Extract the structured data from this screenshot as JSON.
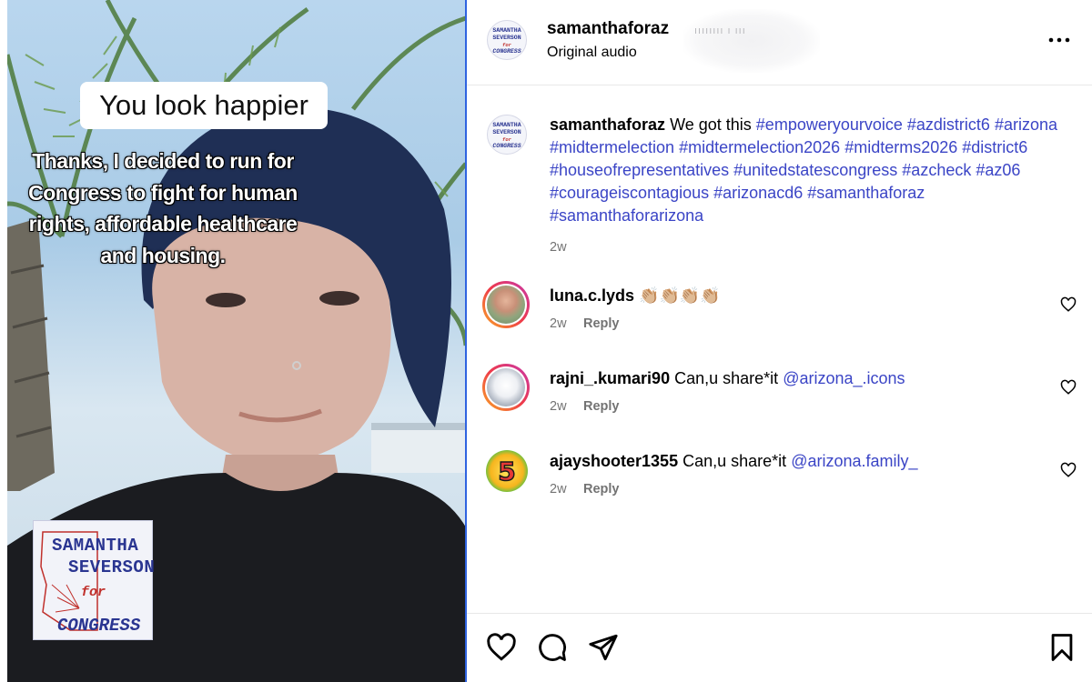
{
  "video": {
    "overlay_top": "You look happier",
    "overlay_lines": [
      "Thanks, I decided to run for",
      "Congress to fight for human",
      "rights, affordable healthcare",
      "and housing."
    ],
    "logo_text": {
      "line1": "SAMANTHA",
      "line2": "SEVERSON",
      "line3": "for",
      "line4": "CONGRESS"
    }
  },
  "header": {
    "username": "samanthaforaz",
    "audio": "Original audio",
    "blurred_text": "ıııııııı ı ııı",
    "more_icon": "more-horizontal-icon"
  },
  "avatar_logo": {
    "line1": "SAMANTHA",
    "line2": "SEVERSON",
    "line3": "for",
    "line4": "CONGRESS"
  },
  "post": {
    "username": "samanthaforaz",
    "text": "We got this",
    "hashtags": [
      "#empoweryourvoice",
      "#azdistrict6",
      "#arizona",
      "#midtermelection",
      "#midtermelection2026",
      "#midterms2026",
      "#district6",
      "#houseofrepresentatives",
      "#unitedstatescongress",
      "#azcheck",
      "#az06",
      "#courageiscontagious",
      "#arizonacd6",
      "#samanthaforaz",
      "#samanthaforarizona"
    ],
    "time": "2w"
  },
  "comments": [
    {
      "username": "luna.c.lyds",
      "text": "👏🏼👏🏼👏🏼👏🏼",
      "mention": "",
      "time": "2w",
      "reply": "Reply"
    },
    {
      "username": "rajni_.kumari90",
      "text": "Can,u share*it",
      "mention": "@arizona_.icons",
      "time": "2w",
      "reply": "Reply"
    },
    {
      "username": "ajayshooter1355",
      "text": "Can,u share*it",
      "mention": "@arizona.family_",
      "time": "2w",
      "reply": "Reply"
    }
  ],
  "actions": {
    "like": "heart-icon",
    "comment": "comment-icon",
    "share": "share-icon",
    "save": "bookmark-icon"
  },
  "colors": {
    "hashtag": "#3b45c6",
    "divider": "#2f63e0",
    "muted": "#737373"
  }
}
